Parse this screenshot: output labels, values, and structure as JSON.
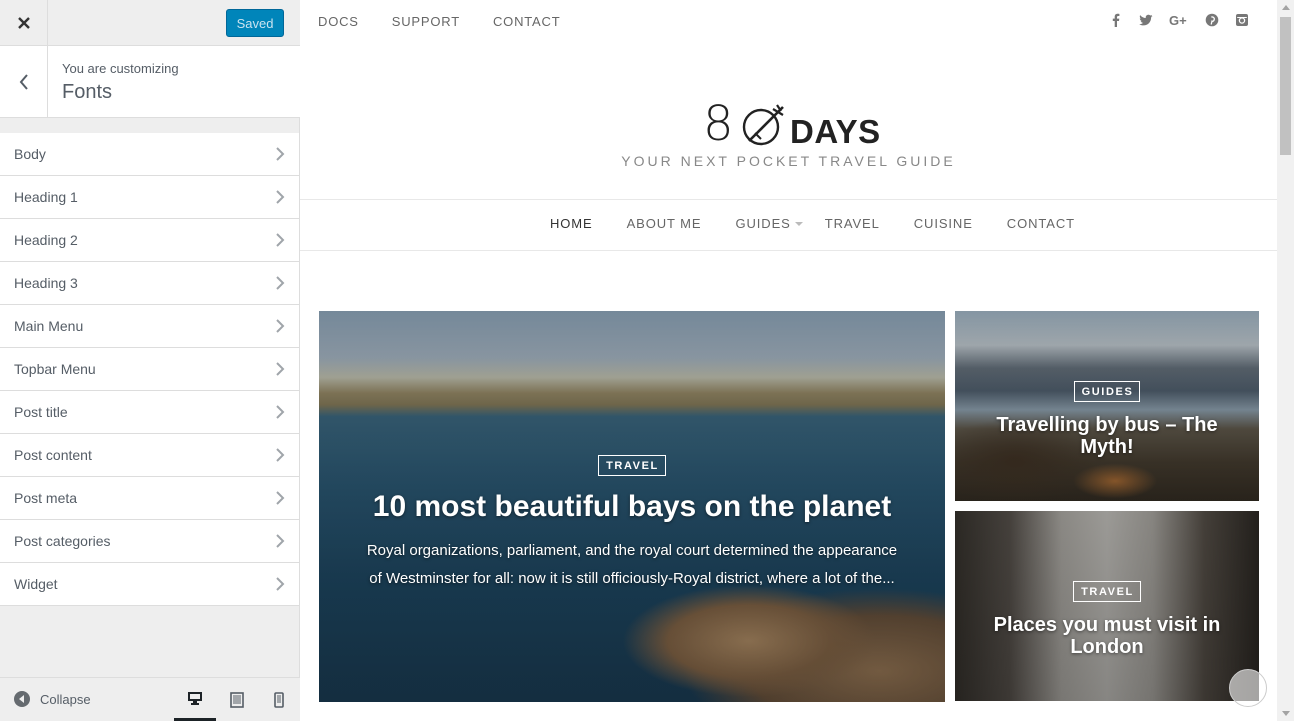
{
  "sidebar": {
    "close_icon": "close-icon",
    "saved_label": "Saved",
    "customizing_label": "You are customizing",
    "section_title": "Fonts",
    "items": [
      {
        "label": "Body"
      },
      {
        "label": "Heading 1"
      },
      {
        "label": "Heading 2"
      },
      {
        "label": "Heading 3"
      },
      {
        "label": "Main Menu"
      },
      {
        "label": "Topbar Menu"
      },
      {
        "label": "Post title"
      },
      {
        "label": "Post content"
      },
      {
        "label": "Post meta"
      },
      {
        "label": "Post categories"
      },
      {
        "label": "Widget"
      }
    ],
    "collapse_label": "Collapse",
    "devices": [
      "desktop",
      "tablet",
      "mobile"
    ],
    "active_device": "desktop",
    "accent_color": "#0085ba"
  },
  "preview": {
    "topbar": {
      "links": [
        "DOCS",
        "SUPPORT",
        "CONTACT"
      ],
      "social_icons": [
        "facebook-icon",
        "twitter-icon",
        "google-plus-icon",
        "pinterest-icon",
        "instagram-icon"
      ]
    },
    "logo": {
      "number": "8",
      "word": "DAYS",
      "tagline": "YOUR NEXT POCKET TRAVEL GUIDE"
    },
    "main_menu": [
      "HOME",
      "ABOUT ME",
      "GUIDES",
      "TRAVEL",
      "CUISINE",
      "CONTACT"
    ],
    "featured": {
      "category": "TRAVEL",
      "title": "10 most beautiful bays on the planet",
      "excerpt": "Royal organizations, parliament, and the royal court determined the appearance of Westminster for all: now it is still officiously-Royal district, where a lot of the..."
    },
    "side_posts": [
      {
        "category": "GUIDES",
        "title": "Travelling by bus – The Myth!"
      },
      {
        "category": "TRAVEL",
        "title": "Places you must visit in London"
      }
    ]
  }
}
